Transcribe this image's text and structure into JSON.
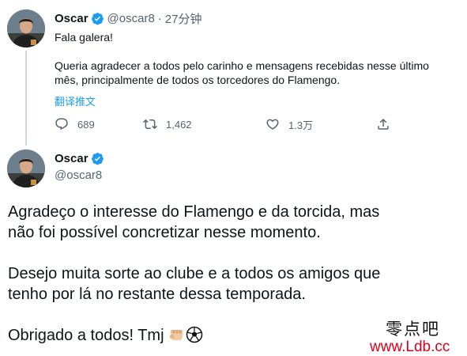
{
  "tweet1": {
    "name": "Oscar",
    "handle": "@oscar8",
    "time": "27分钟",
    "line1": "Fala galera!",
    "line2": "Queria agradecer a todos pelo carinho e mensagens recebidas nesse último",
    "line3": "mês, principalmente de todos os torcedores do Flamengo.",
    "translate": "翻译推文",
    "replies": "689",
    "retweets": "1,462",
    "likes": "1.3万",
    "icons": [
      "reply-icon",
      "retweet-icon",
      "like-icon",
      "share-icon",
      "verified-icon"
    ],
    "accent": "#1d9bf0"
  },
  "tweet2": {
    "name": "Oscar",
    "handle": "@oscar8",
    "p1_l1": "Agradeço o interesse do Flamengo e da torcida, mas",
    "p1_l2": "não foi possível concretizar nesse momento.",
    "p2_l1": "Desejo muita sorte ao clube e a todos os amigos que",
    "p2_l2": "tenho por lá no restante dessa temporada.",
    "p3": "Obrigado a todos! Tmj",
    "emojis": [
      "fist-emoji",
      "soccer-ball-emoji"
    ]
  },
  "watermark": {
    "title": "零点吧",
    "url": "www.Ldb.cc",
    "color": "#e0001b"
  }
}
